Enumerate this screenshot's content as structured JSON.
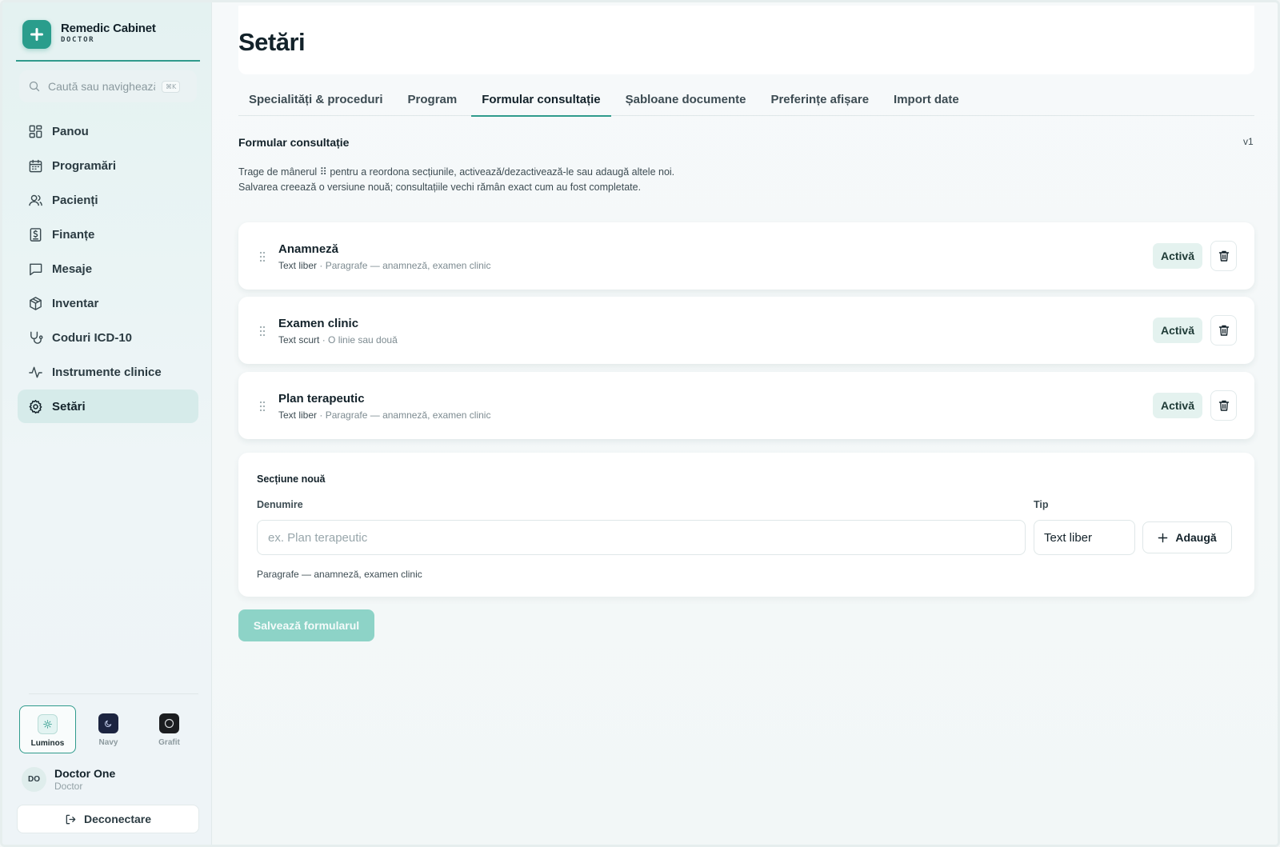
{
  "brand": {
    "name": "Remedic Cabinet",
    "role": "DOCTOR"
  },
  "search": {
    "placeholder": "Caută sau navighează",
    "shortcut": "⌘K"
  },
  "sidebar": {
    "items": [
      {
        "label": "Panou",
        "icon": "dashboard-icon"
      },
      {
        "label": "Programări",
        "icon": "calendar-icon"
      },
      {
        "label": "Pacienți",
        "icon": "users-icon"
      },
      {
        "label": "Finanțe",
        "icon": "receipt-icon"
      },
      {
        "label": "Mesaje",
        "icon": "message-icon"
      },
      {
        "label": "Inventar",
        "icon": "package-icon"
      },
      {
        "label": "Coduri ICD-10",
        "icon": "stethoscope-icon"
      },
      {
        "label": "Instrumente clinice",
        "icon": "activity-icon"
      },
      {
        "label": "Setări",
        "icon": "settings-icon",
        "active": true
      }
    ]
  },
  "themes": [
    {
      "name": "Luminos",
      "selected": true
    },
    {
      "name": "Navy",
      "selected": false
    },
    {
      "name": "Grafit",
      "selected": false
    }
  ],
  "user": {
    "initials": "DO",
    "name": "Doctor One",
    "role": "Doctor"
  },
  "logout_label": "Deconectare",
  "page": {
    "title": "Setări",
    "tabs": [
      {
        "label": "Specialități & proceduri",
        "active": false
      },
      {
        "label": "Program",
        "active": false
      },
      {
        "label": "Formular consultație",
        "active": true
      },
      {
        "label": "Șabloane documente",
        "active": false
      },
      {
        "label": "Preferințe afișare",
        "active": false
      },
      {
        "label": "Import date",
        "active": false
      }
    ]
  },
  "form": {
    "title": "Formular consultație",
    "version": "v1",
    "description_before": "Trage de mânerul ",
    "description_handle": "⠿",
    "description_after": " pentru a reordona secțiunile, activează/dezactivează-le sau adaugă altele noi. Salvarea creează o versiune nouă; consultațiile vechi rămân exact cum au fost completate.",
    "fields": [
      {
        "name": "Anamneză",
        "type": "Text liber",
        "type_desc": " · Paragrafe — anamneză, examen clinic",
        "status": "Activă"
      },
      {
        "name": "Examen clinic",
        "type": "Text scurt",
        "type_desc": " · O linie sau două",
        "status": "Activă"
      },
      {
        "name": "Plan terapeutic",
        "type": "Text liber",
        "type_desc": " · Paragrafe — anamneză, examen clinic",
        "status": "Activă"
      }
    ],
    "new_section": {
      "title": "Secțiune nouă",
      "name_label": "Denumire",
      "name_placeholder": "ex. Plan terapeutic",
      "name_value": "",
      "type_label": "Tip",
      "type_value": "Text liber",
      "add_label": "Adaugă",
      "hint": "Paragrafe — anamneză, examen clinic"
    },
    "save_label": "Salvează formularul"
  },
  "colors": {
    "accent": "#2f9b8c",
    "accent_light": "#8dd3c7",
    "active_nav": "#d6ebea"
  }
}
